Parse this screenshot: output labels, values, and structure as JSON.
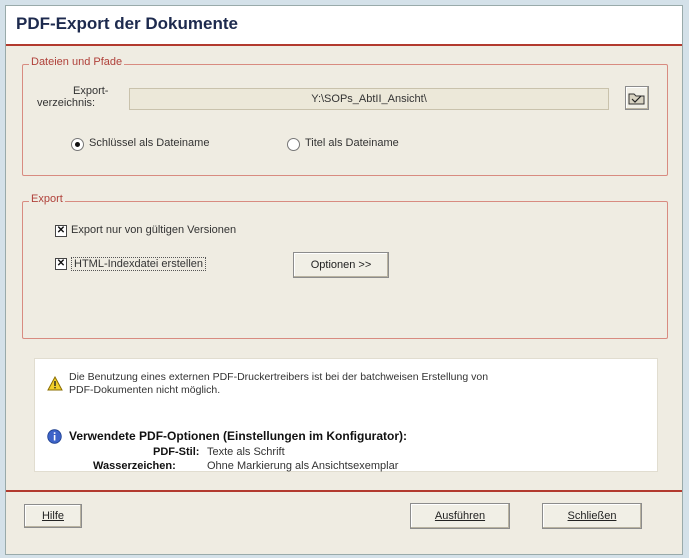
{
  "window": {
    "title": "PDF-Export der Dokumente"
  },
  "paths_group": {
    "legend": "Dateien und Pfade",
    "export_dir_label_line1": "Export-",
    "export_dir_label_line2": "verzeichnis:",
    "export_dir_value": "Y:\\SOPs_AbtII_Ansicht\\",
    "radio_key": {
      "label": "Schlüssel als Dateiname",
      "selected": true
    },
    "radio_title": {
      "label": "Titel als Dateiname",
      "selected": false
    }
  },
  "export_group": {
    "legend": "Export",
    "chk_valid": {
      "label": "Export nur von gültigen Versionen",
      "checked": true
    },
    "chk_html": {
      "label": "HTML-Indexdatei erstellen",
      "checked": true
    },
    "options_button": "Optionen  >>"
  },
  "info": {
    "warning_line1": "Die Benutzung eines externen PDF-Druckertreibers ist bei der batchweisen Erstellung von",
    "warning_line2": "PDF-Dokumenten nicht möglich.",
    "heading": "Verwendete PDF-Optionen (Einstellungen im Konfigurator):",
    "pdf_style_label": "PDF-Stil:",
    "pdf_style_value": "Texte als Schrift",
    "watermark_label": "Wasserzeichen:",
    "watermark_value": "Ohne Markierung als Ansichtsexemplar"
  },
  "footer": {
    "help": "Hilfe",
    "execute": "Ausführen",
    "close": "Schließen"
  },
  "colors": {
    "accent": "#b23a2e",
    "legend": "#b0413a",
    "title": "#1d2a4e"
  }
}
